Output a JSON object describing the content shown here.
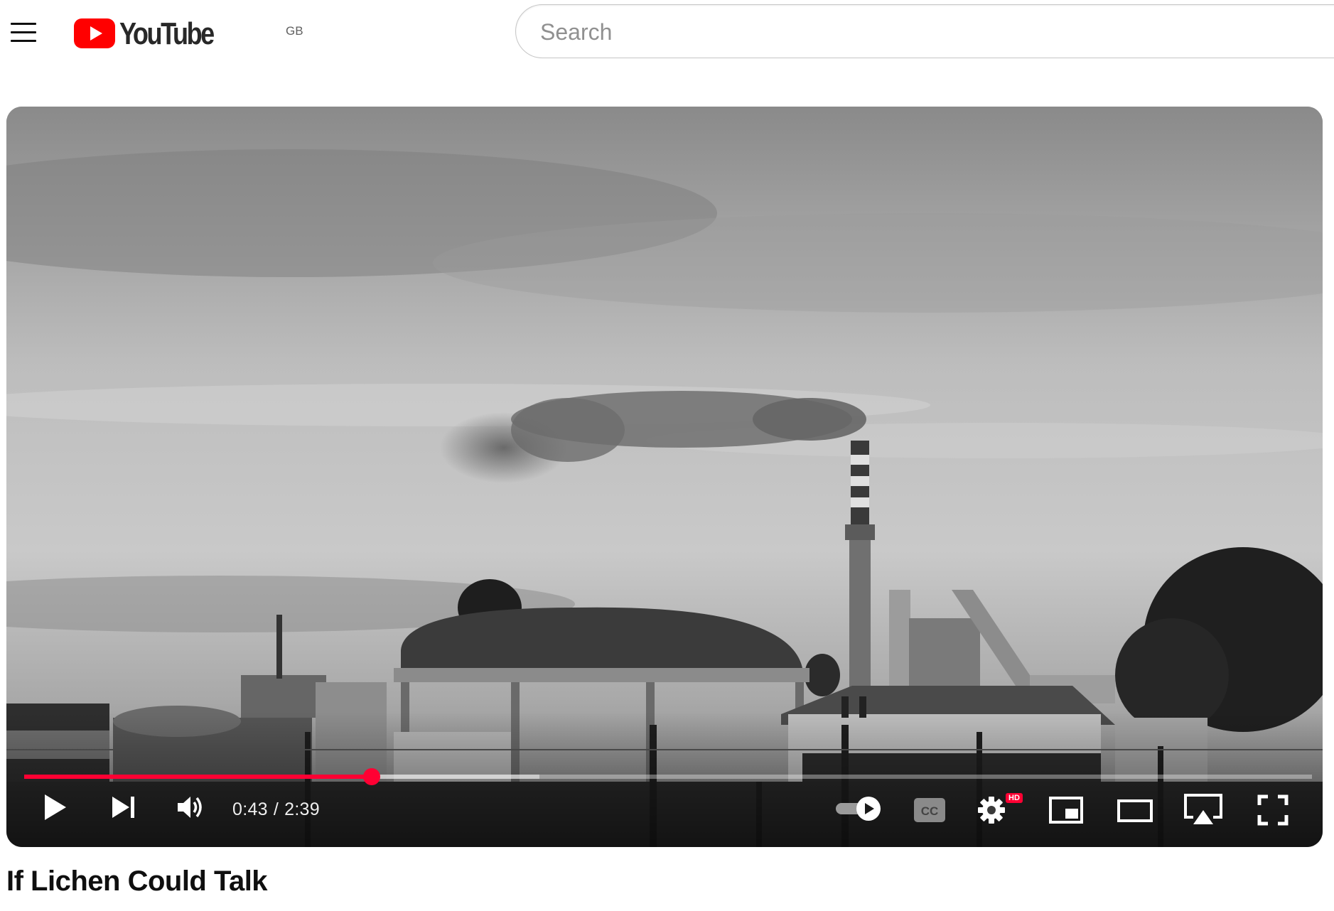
{
  "header": {
    "logo_text": "YouTube",
    "country_code": "GB",
    "search_placeholder": "Search"
  },
  "player": {
    "current_time": "0:43",
    "separator": "/",
    "duration": "2:39",
    "progress_fraction": 0.27,
    "buffered_fraction": 0.4,
    "settings_badge": "HD",
    "autoplay_on": true,
    "colors": {
      "progress": "#ff0033",
      "logo_red": "#ff0000"
    }
  },
  "video": {
    "title": "If Lichen Could Talk"
  },
  "icons": [
    "menu-icon",
    "youtube-play-icon",
    "play-icon",
    "next-icon",
    "volume-icon",
    "autoplay-toggle-icon",
    "captions-icon",
    "settings-icon",
    "miniplayer-icon",
    "theater-mode-icon",
    "cast-icon",
    "fullscreen-icon"
  ]
}
